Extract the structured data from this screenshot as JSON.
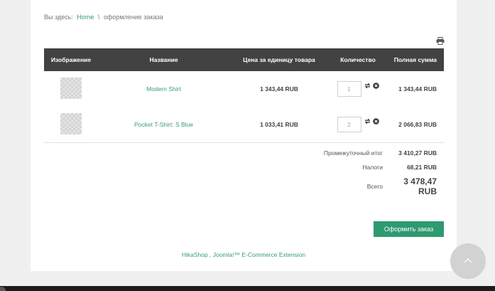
{
  "breadcrumb": {
    "prefix": "Вы здесь:",
    "home": "Home",
    "separator": "\\",
    "current": "оформление заказа"
  },
  "icons": {
    "print": "print-icon",
    "refresh": "refresh-icon",
    "remove": "remove-icon",
    "scroll_top": "chevron-up-icon"
  },
  "table": {
    "headers": {
      "image": "Изображение",
      "name": "Название",
      "unit_price": "Цена за единицу товара",
      "quantity": "Количество",
      "total": "Полная сумма"
    },
    "rows": [
      {
        "name": "Modern Shirt",
        "unit_price": "1 343,44 RUB",
        "quantity": "1",
        "total": "1 343,44 RUB"
      },
      {
        "name": "Pocket T-Shirt: S Blue",
        "unit_price": "1 033,41 RUB",
        "quantity": "2",
        "total": "2 066,83 RUB"
      }
    ]
  },
  "summary": {
    "subtotal_label": "Промежуточный итог",
    "subtotal_value": "3 410,27 RUB",
    "taxes_label": "Налоги",
    "taxes_value": "68,21 RUB",
    "total_label": "Всего",
    "total_value_amount": "3 478,47",
    "total_value_currency": "RUB"
  },
  "checkout_label": "Оформить заказ",
  "footer": {
    "credit": "HikaShop , Joomla!™ E-Commerce Extension"
  },
  "colors": {
    "accent": "#2e9a6f",
    "link": "#3a9a78",
    "header_bg": "#424242"
  }
}
